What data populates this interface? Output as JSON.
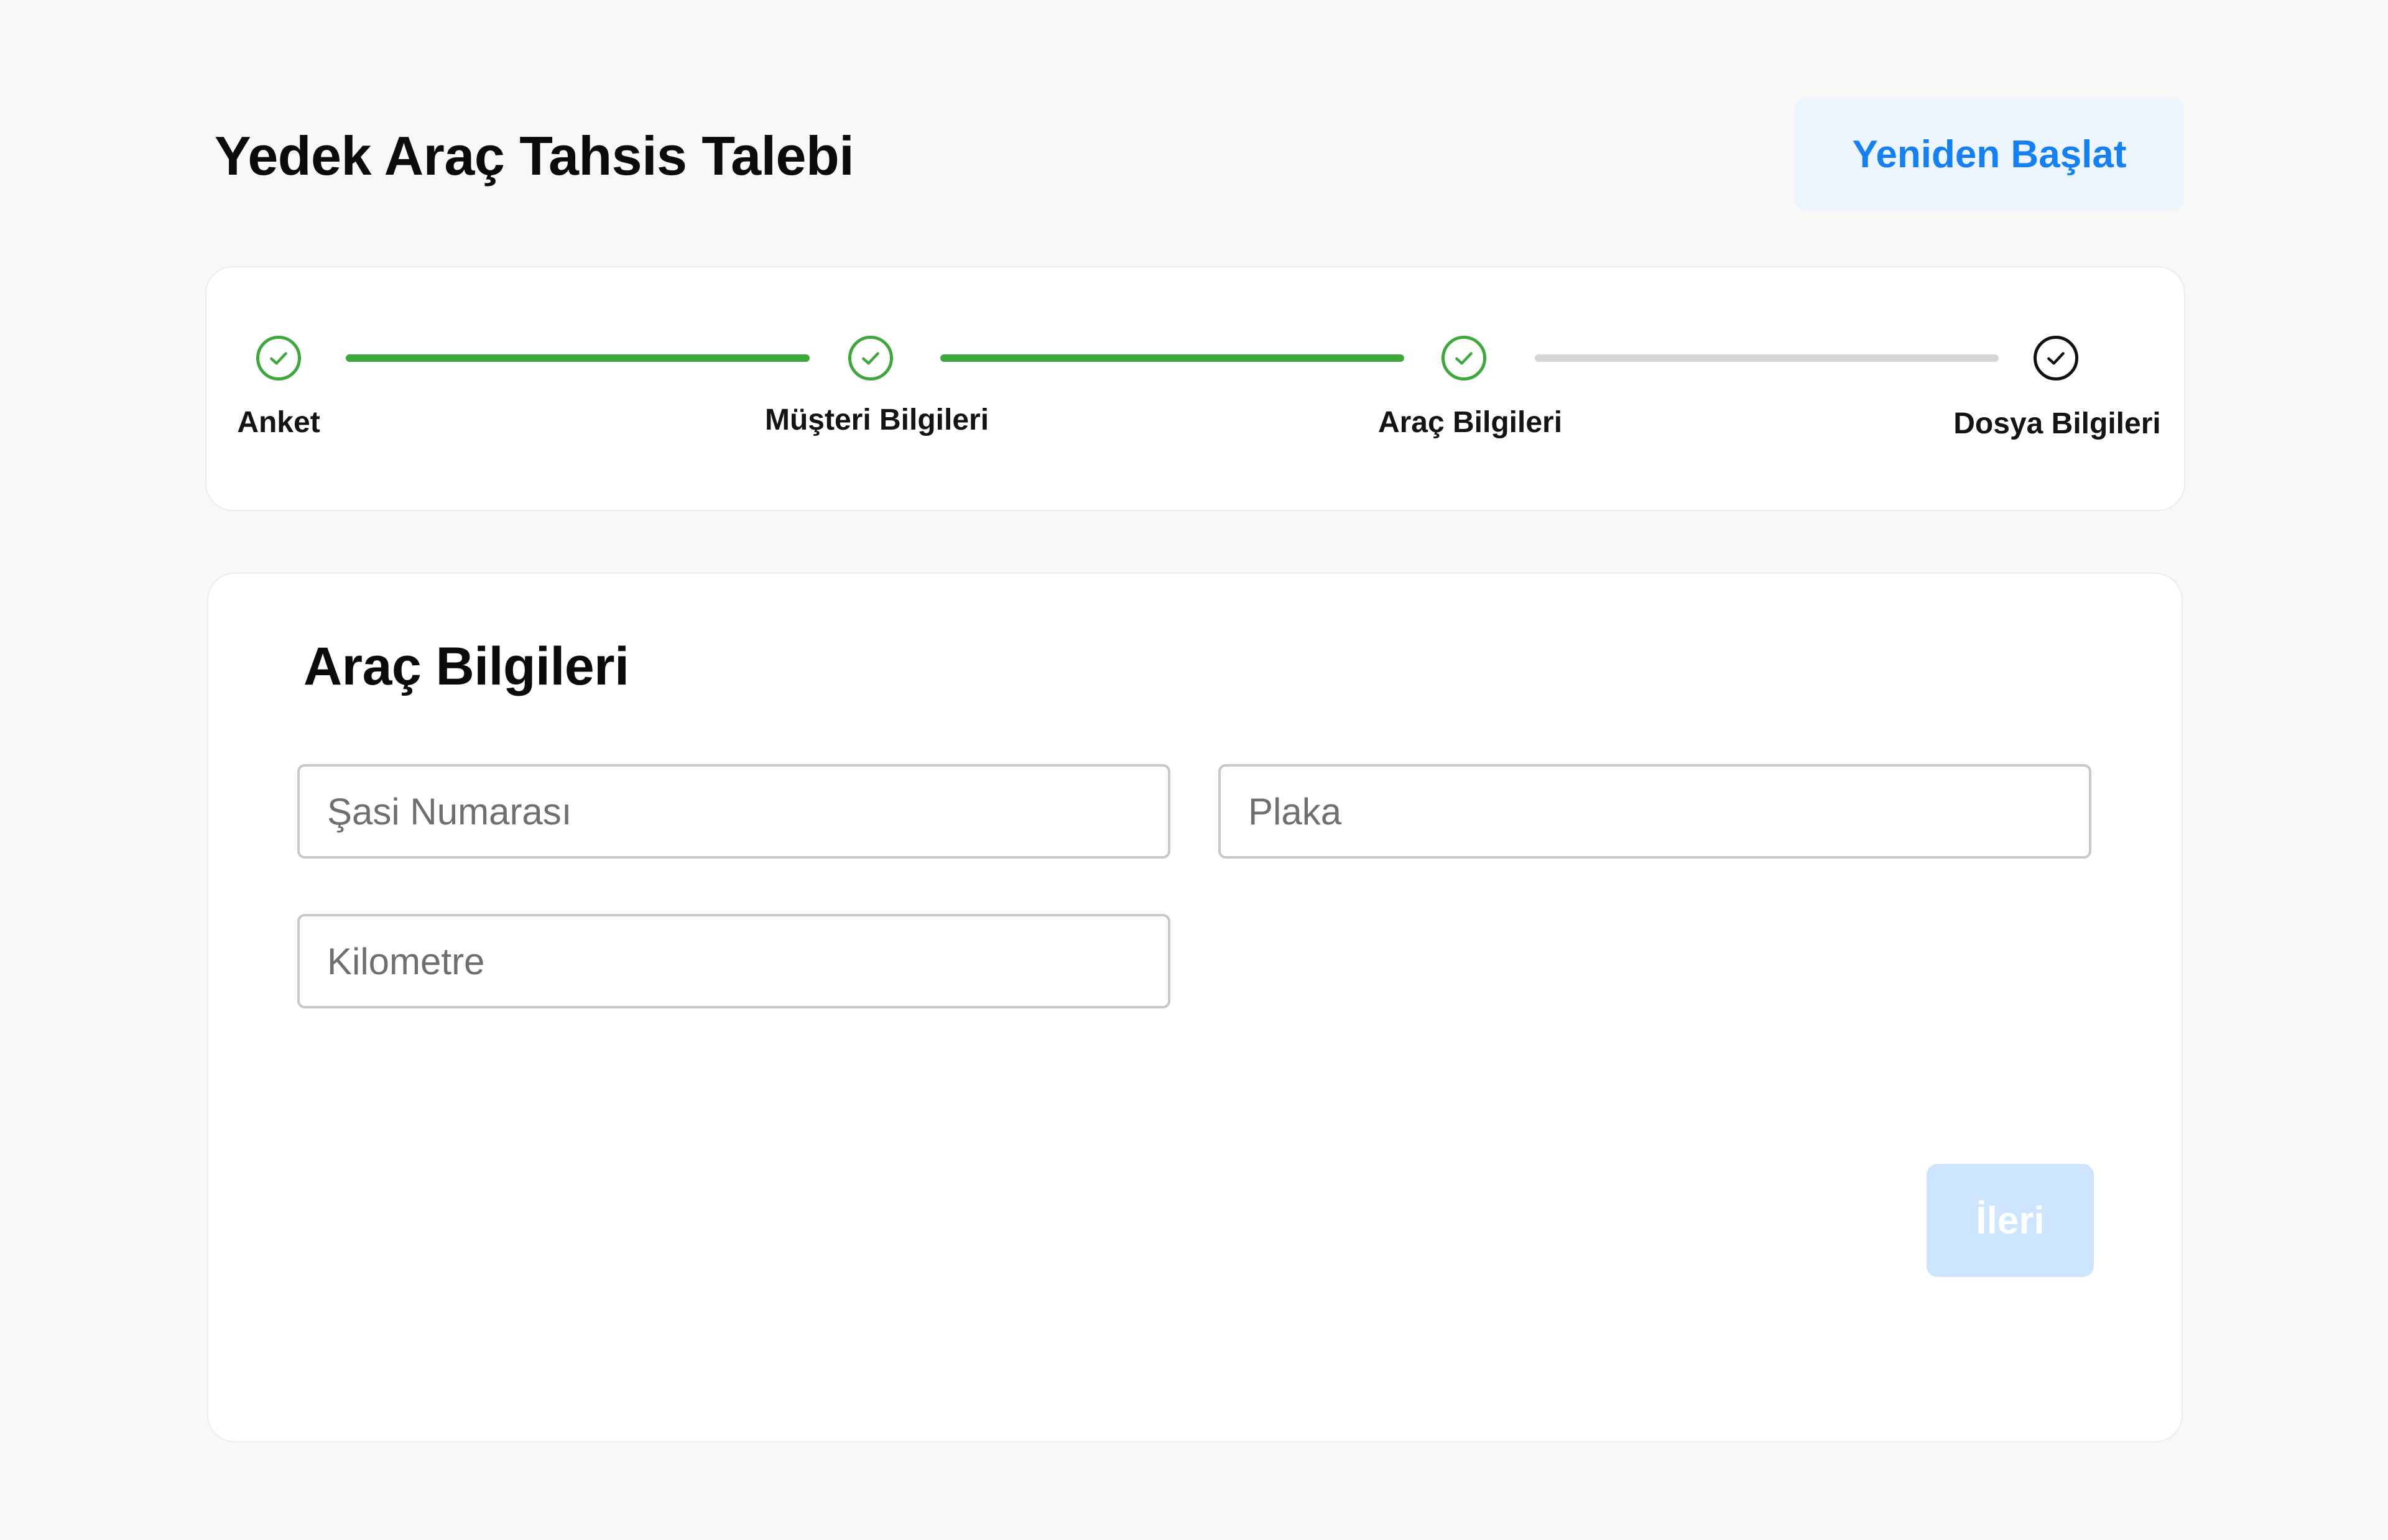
{
  "header": {
    "title": "Yedek Araç Tahsis Talebi",
    "restart_label": "Yeniden Başlat"
  },
  "stepper": {
    "steps": [
      {
        "label": "Anket",
        "status": "completed"
      },
      {
        "label": "Müşteri Bilgileri",
        "status": "completed"
      },
      {
        "label": "Araç Bilgileri",
        "status": "completed"
      },
      {
        "label": "Dosya Bilgileri",
        "status": "current"
      }
    ],
    "colors": {
      "completed": "#3ea83e",
      "pending_line": "#d6d6d6",
      "current": "#111111"
    }
  },
  "form": {
    "title": "Araç Bilgileri",
    "fields": {
      "chassis": {
        "placeholder": "Şasi Numarası",
        "value": ""
      },
      "plate": {
        "placeholder": "Plaka",
        "value": ""
      },
      "mileage": {
        "placeholder": "Kilometre",
        "value": ""
      }
    },
    "next_label": "İleri",
    "next_disabled": true
  },
  "colors": {
    "background": "#f8f8f8",
    "accent": "#1780f0",
    "accent_soft": "#ecf4fe",
    "disabled_button": "#cce4fd"
  },
  "icons": {
    "step_completed": "check-circle-icon",
    "step_current": "check-circle-icon"
  }
}
